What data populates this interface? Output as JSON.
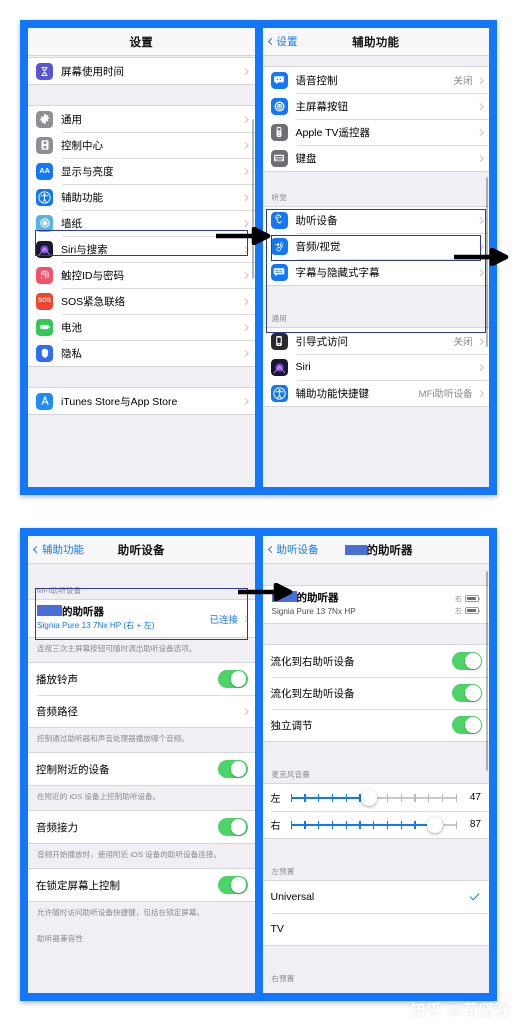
{
  "watermark": "知乎 @苟坚强",
  "panel_settings": {
    "title": "设置",
    "groups": [
      {
        "items": [
          {
            "label": "屏幕使用时间",
            "icon": "hourglass-icon",
            "value": "",
            "accessory": "chevron"
          }
        ]
      },
      {
        "items": [
          {
            "label": "通用",
            "icon": "gear-icon",
            "value": "",
            "accessory": "chevron"
          },
          {
            "label": "控制中心",
            "icon": "control-center-icon",
            "value": "",
            "accessory": "chevron"
          },
          {
            "label": "显示与亮度",
            "icon": "aa-icon",
            "value": "",
            "accessory": "chevron"
          },
          {
            "label": "辅助功能",
            "icon": "accessibility-icon",
            "value": "",
            "accessory": "chevron",
            "highlighted": true
          },
          {
            "label": "墙纸",
            "icon": "wallpaper-icon",
            "value": "",
            "accessory": "chevron"
          },
          {
            "label": "Siri与搜索",
            "icon": "siri-icon",
            "value": "",
            "accessory": "chevron"
          },
          {
            "label": "触控ID与密码",
            "icon": "touchid-icon",
            "value": "",
            "accessory": "chevron"
          },
          {
            "label": "SOS紧急联络",
            "icon": "sos-icon",
            "value": "",
            "accessory": "chevron"
          },
          {
            "label": "电池",
            "icon": "battery-icon",
            "value": "",
            "accessory": "chevron"
          },
          {
            "label": "隐私",
            "icon": "privacy-hand-icon",
            "value": "",
            "accessory": "chevron"
          }
        ]
      },
      {
        "items": [
          {
            "label": "iTunes Store与App Store",
            "icon": "appstore-icon",
            "value": "",
            "accessory": "chevron"
          }
        ]
      }
    ]
  },
  "panel_accessibility": {
    "back_label": "设置",
    "title": "辅助功能",
    "groups": [
      {
        "header": "",
        "items": [
          {
            "label": "语音控制",
            "icon": "voice-control-icon",
            "value": "关闭",
            "accessory": "chevron"
          },
          {
            "label": "主屏幕按钮",
            "icon": "home-button-icon",
            "value": "",
            "accessory": "chevron"
          },
          {
            "label": "Apple TV遥控器",
            "icon": "apple-tv-remote-icon",
            "value": "",
            "accessory": "chevron"
          },
          {
            "label": "键盘",
            "icon": "keyboard-icon",
            "value": "",
            "accessory": "chevron"
          }
        ]
      },
      {
        "header": "听觉",
        "highlight_group": true,
        "items": [
          {
            "label": "助听设备",
            "icon": "hearing-aid-icon",
            "value": "",
            "accessory": "chevron",
            "highlighted": true
          },
          {
            "label": "音频/视觉",
            "icon": "audio-visual-icon",
            "value": "",
            "accessory": "chevron"
          },
          {
            "label": "字幕与隐藏式字幕",
            "icon": "subtitles-icon",
            "value": "",
            "accessory": "chevron"
          }
        ]
      },
      {
        "header": "通用",
        "items": [
          {
            "label": "引导式访问",
            "icon": "guided-access-icon",
            "value": "关闭",
            "accessory": "chevron"
          },
          {
            "label": "Siri",
            "icon": "siri-icon",
            "value": "",
            "accessory": "chevron"
          },
          {
            "label": "辅助功能快捷键",
            "icon": "accessibility-icon",
            "value": "MFi助听设备",
            "accessory": "chevron"
          }
        ]
      }
    ]
  },
  "panel_hearing_devices": {
    "back_label": "辅助功能",
    "title": "助听设备",
    "mfi_header": "MFI助听设备",
    "device": {
      "name_suffix": "的助听器",
      "model": "Signia Pure 13 7Nx HP (右 + 左)",
      "status": "已连接"
    },
    "mfi_footer": "连按三次主屏幕按钮可随时调出助听设备选项。",
    "settings": [
      {
        "label": "播放铃声",
        "control": "toggle",
        "on": true,
        "footer": ""
      },
      {
        "label": "音频路径",
        "control": "chevron",
        "on": false,
        "footer": "控制通过助听器和声音处理器播放哪个音频。"
      },
      {
        "label": "控制附近的设备",
        "control": "toggle",
        "on": true,
        "footer": "在附近的 iOS 设备上控制助听设备。"
      },
      {
        "label": "音频接力",
        "control": "toggle",
        "on": true,
        "footer": "音频开始播放时，使用附近 iOS 设备的助听设备连接。"
      },
      {
        "label": "在锁定屏幕上控制",
        "control": "toggle",
        "on": true,
        "footer": "允许随时访问助听设备快捷键，包括在锁定屏幕。"
      }
    ],
    "compat_header": "助听器兼容性"
  },
  "panel_device_detail": {
    "back_label": "助听设备",
    "title_suffix": "的助听器",
    "device": {
      "name_suffix": "的助听器",
      "model": "Signia Pure 13 7Nx HP",
      "right_label": "右",
      "left_label": "左"
    },
    "toggles": [
      {
        "label": "流化到右助听设备",
        "on": true
      },
      {
        "label": "流化到左助听设备",
        "on": true
      },
      {
        "label": "独立调节",
        "on": true
      }
    ],
    "mic_header": "麦克风音量",
    "sliders": [
      {
        "label": "左",
        "value": 47,
        "min": 0,
        "max": 100
      },
      {
        "label": "右",
        "value": 87,
        "min": 0,
        "max": 100
      }
    ],
    "preset_header": "左预置",
    "presets": [
      {
        "label": "Universal",
        "selected": true
      },
      {
        "label": "TV",
        "selected": false
      }
    ],
    "next_header": "右预置"
  },
  "colors": {
    "frame_blue": "#1277fb",
    "highlight_navy": "#2b3a9c",
    "toggle_green": "#4cd469",
    "redaction": "#4a6fd4",
    "accent_blue": "#1277fb"
  }
}
